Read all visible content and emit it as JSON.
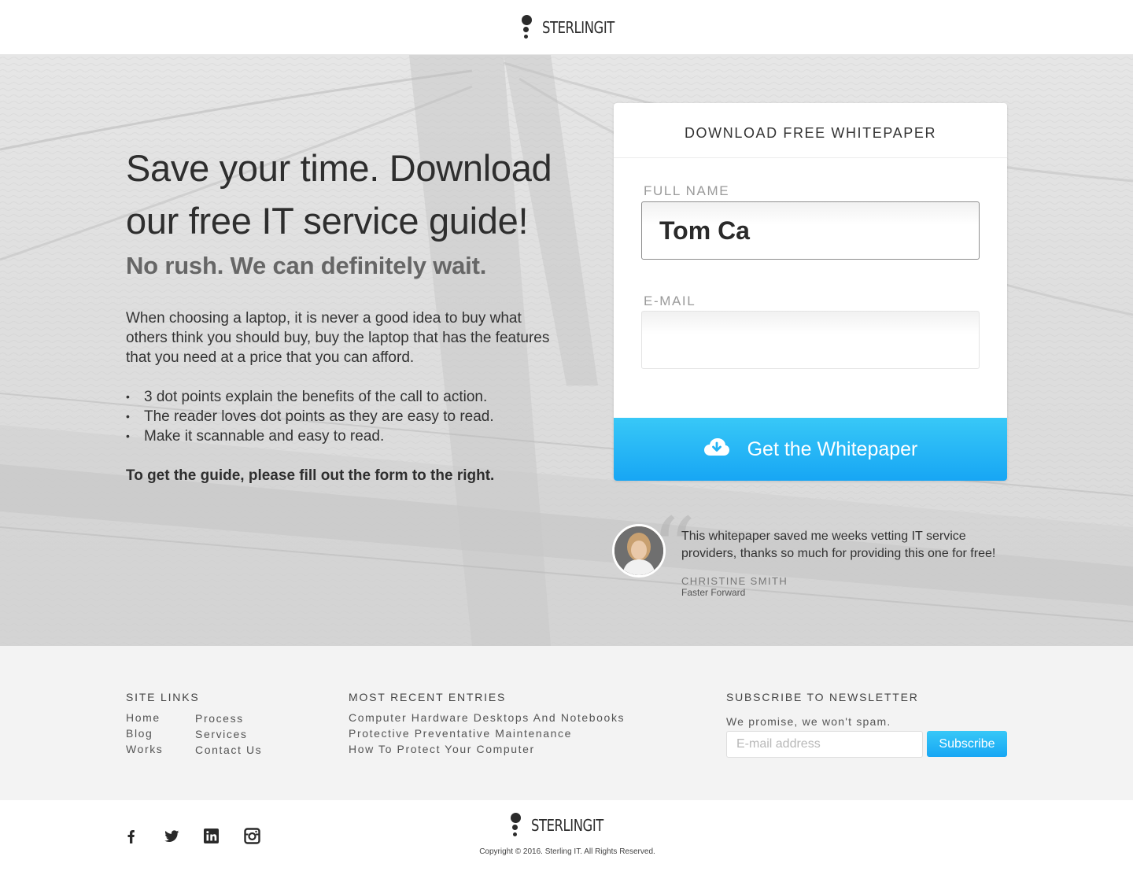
{
  "header": {
    "logo_text": "STERLINGIT"
  },
  "hero": {
    "title": "Save your time. Download our free IT service guide!",
    "subtitle": "No rush. We can definitely wait.",
    "body": "When choosing a laptop, it is never a good idea to buy what others think you should buy, buy the laptop that has the features that you need at a price that you can afford.",
    "bullets": [
      "3 dot points explain the benefits of the call to action.",
      "The reader loves dot points as they are easy to read.",
      "Make it scannable and easy to read."
    ],
    "cta_text": "To get the guide, please fill out the form to the right."
  },
  "form": {
    "heading": "DOWNLOAD FREE WHITEPAPER",
    "full_name_label": "FULL NAME",
    "full_name_value": "Tom Ca",
    "email_label": "E-MAIL",
    "email_value": "",
    "submit_label": "Get the Whitepaper",
    "submit_icon": "cloud-download-icon"
  },
  "testimonial": {
    "quote": "This whitepaper saved me weeks vetting IT service providers, thanks so much for providing this one for free!",
    "name": "CHRISTINE SMITH",
    "company": "Faster Forward"
  },
  "footer": {
    "site_links_heading": "SITE LINKS",
    "site_links_col1": [
      "Home",
      "Blog",
      "Works"
    ],
    "site_links_col2": [
      "Process",
      "Services",
      "Contact Us"
    ],
    "recent_heading": "MOST RECENT ENTRIES",
    "recent_entries": [
      "Computer Hardware Desktops And Notebooks",
      "Protective Preventative Maintenance",
      "How To Protect Your Computer"
    ],
    "newsletter_heading": "SUBSCRIBE TO NEWSLETTER",
    "newsletter_note": "We promise, we won't spam.",
    "newsletter_placeholder": "E-mail address",
    "subscribe_label": "Subscribe",
    "social_icons": [
      "facebook-icon",
      "twitter-icon",
      "linkedin-icon",
      "instagram-icon"
    ],
    "logo_text": "STERLINGIT",
    "copyright": "Copyright © 2016.  Sterling IT.  All Rights Reserved."
  },
  "colors": {
    "accent_top": "#38c8f7",
    "accent_bottom": "#17a6f4",
    "text_dark": "#333333",
    "footer_bg": "#f3f3f3"
  }
}
